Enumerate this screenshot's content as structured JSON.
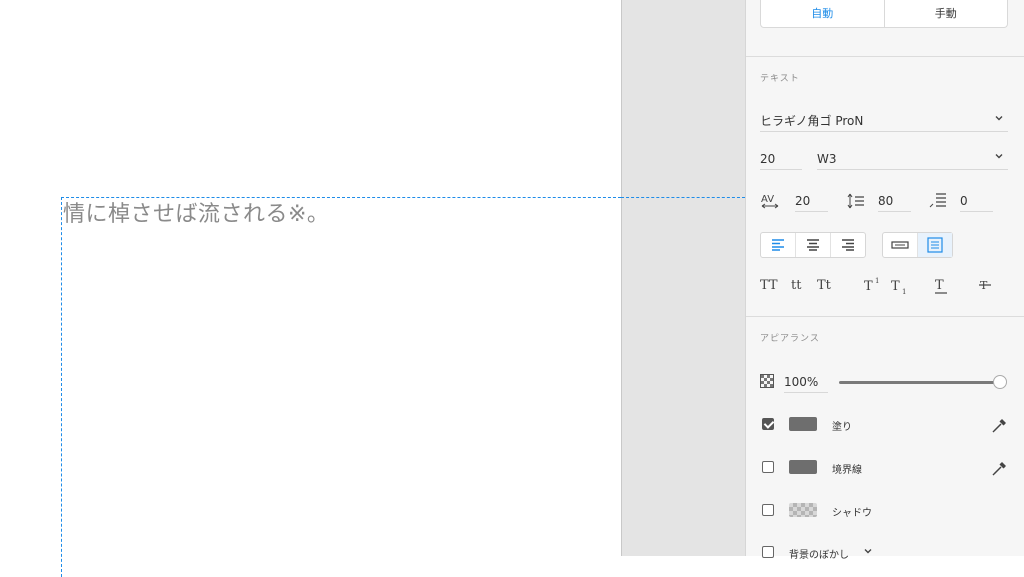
{
  "canvas": {
    "text_content": "情に棹させば流される※。"
  },
  "panel": {
    "sizing": {
      "auto_label": "自動",
      "manual_label": "手動"
    },
    "text_section": {
      "title": "テキスト",
      "font_family": "ヒラギノ角ゴ ProN",
      "font_size": "20",
      "font_weight": "W3",
      "char_spacing": "20",
      "line_spacing": "80",
      "paragraph_spacing": "0",
      "case_buttons": [
        "TT",
        "tt",
        "Tt"
      ]
    },
    "appearance": {
      "title": "アピアランス",
      "opacity": "100%",
      "opacity_value": 100,
      "fill_label": "塗り",
      "fill_checked": true,
      "fill_color": "#6e6e6e",
      "border_label": "境界線",
      "border_checked": false,
      "border_color": "#6e6e6e",
      "shadow_label": "シャドウ",
      "shadow_checked": false,
      "bg_blur_label": "背景のぼかし",
      "bg_blur_checked": false
    },
    "accent_color": "#1e8ce8"
  }
}
